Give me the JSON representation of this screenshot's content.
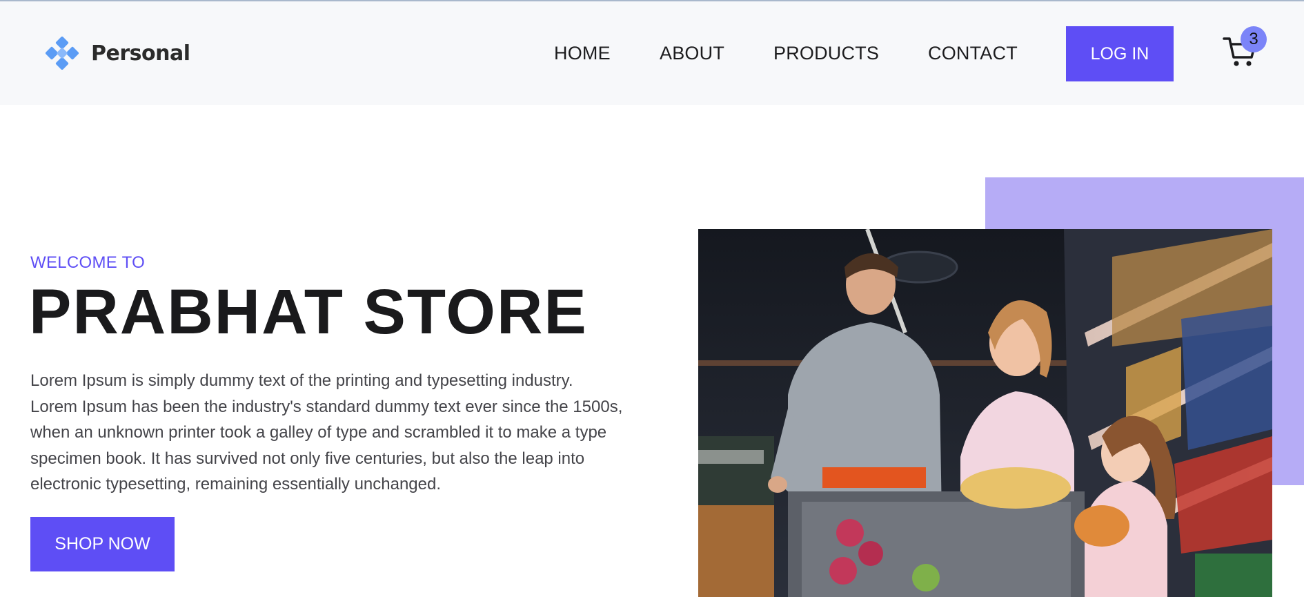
{
  "header": {
    "brand": "Personal",
    "nav": [
      {
        "label": "HOME"
      },
      {
        "label": "ABOUT"
      },
      {
        "label": "PRODUCTS"
      },
      {
        "label": "CONTACT"
      }
    ],
    "login_label": "LOG IN",
    "cart_count": "3"
  },
  "hero": {
    "eyebrow": "WELCOME TO",
    "title": "PRABHAT STORE",
    "description": "Lorem Ipsum is simply dummy text of the printing and typesetting industry. Lorem Ipsum has been the industry's standard dummy text ever since the 1500s, when an unknown printer took a galley of type and scrambled it to make a type specimen book. It has survived not only five centuries, but also the leap into electronic typesetting, remaining essentially unchanged.",
    "cta_label": "SHOP NOW"
  },
  "colors": {
    "accent": "#5e4ef5",
    "accent_light": "#b6acf6",
    "header_bg": "#f7f8fa",
    "logo_blue": "#5b9cf5"
  },
  "icons": {
    "logo": "diamond-cluster-logo-icon",
    "cart": "shopping-cart-icon"
  }
}
